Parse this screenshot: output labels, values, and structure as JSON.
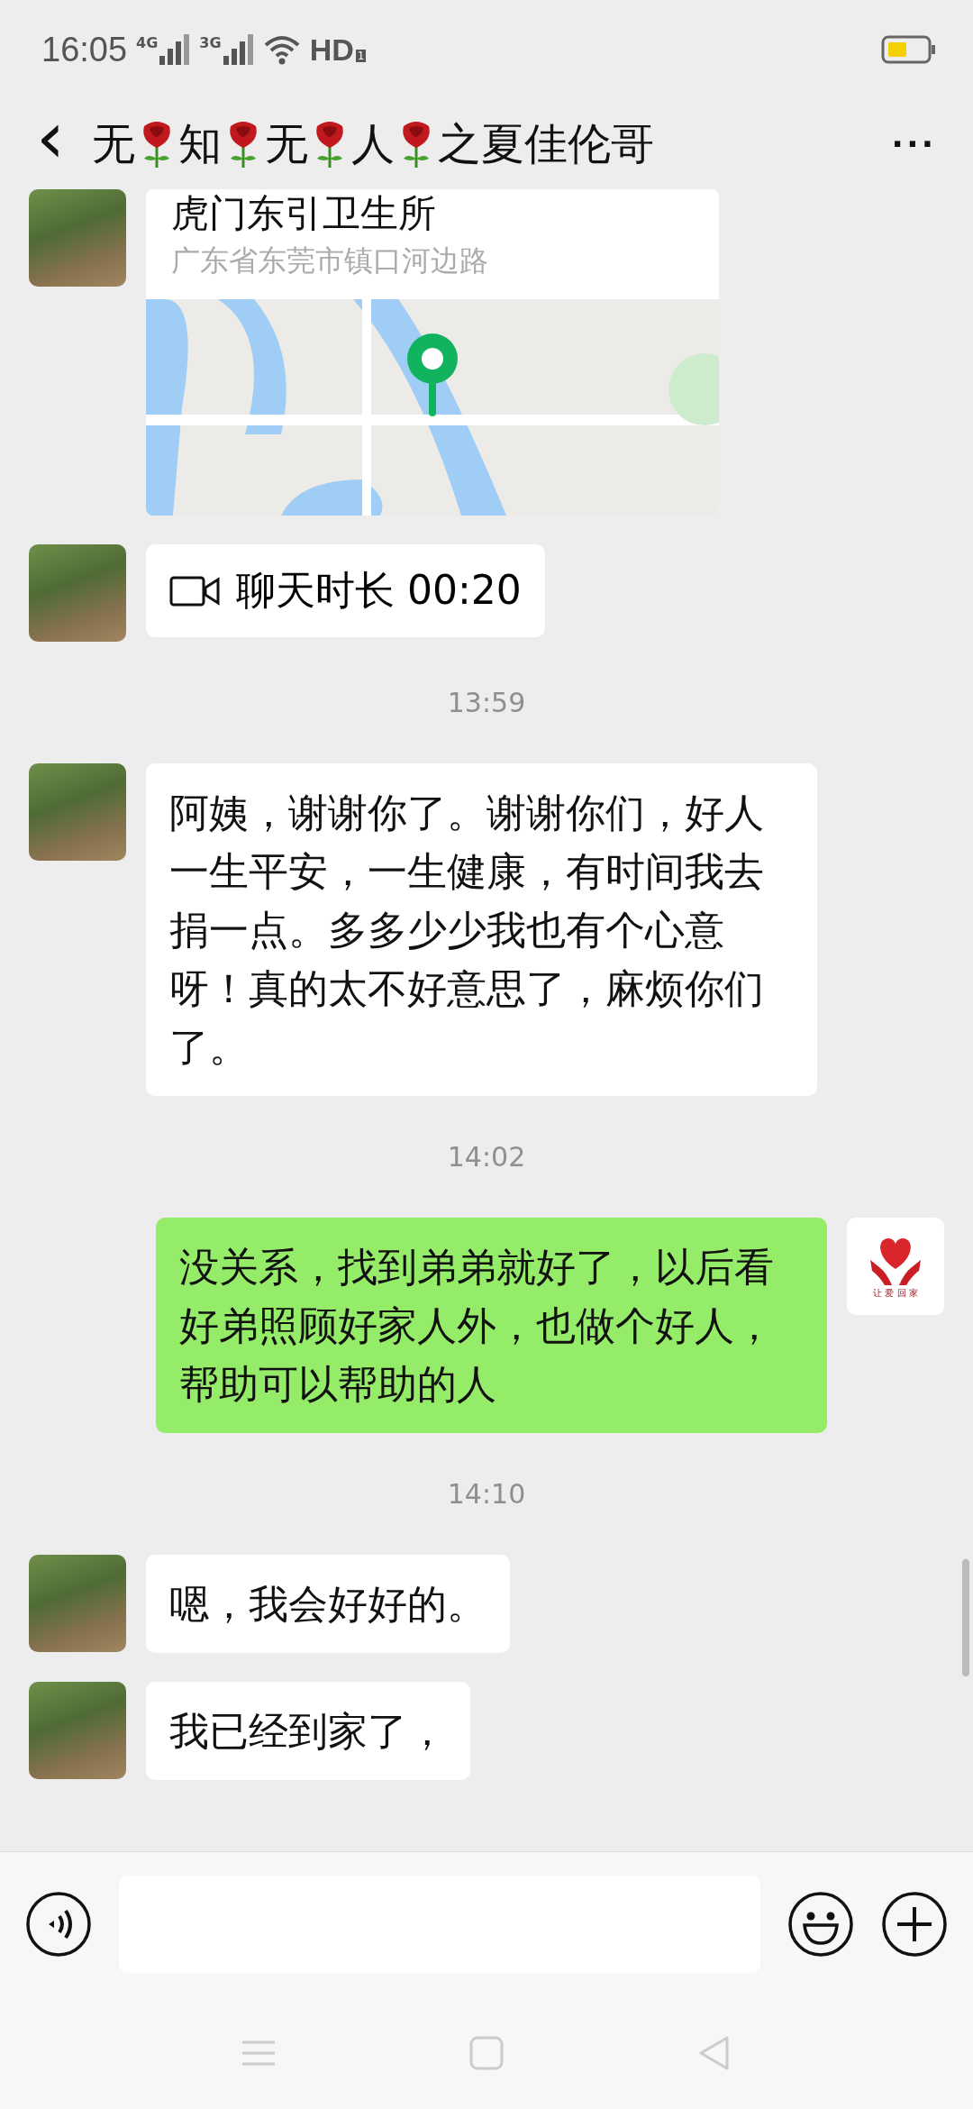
{
  "status_bar": {
    "time": "16:05",
    "network_1": "4G",
    "network_2": "3G",
    "hd": "HD",
    "sim": "1"
  },
  "header": {
    "back": "‹",
    "title": [
      {
        "kind": "text",
        "text": "无"
      },
      {
        "kind": "rose"
      },
      {
        "kind": "text",
        "text": "知"
      },
      {
        "kind": "rose"
      },
      {
        "kind": "text",
        "text": "无"
      },
      {
        "kind": "rose"
      },
      {
        "kind": "text",
        "text": "人"
      },
      {
        "kind": "rose"
      },
      {
        "kind": "text",
        "text": "之夏佳伦哥"
      }
    ],
    "more": "···"
  },
  "messages": [
    {
      "kind": "location",
      "mine": false,
      "title": "虎门东引卫生所",
      "address": "广东省东莞市镇口河边路"
    },
    {
      "kind": "call",
      "mine": false,
      "text": "聊天时长 00:20"
    },
    {
      "kind": "time",
      "text": "13:59"
    },
    {
      "kind": "text",
      "mine": false,
      "text": "阿姨，谢谢你了。谢谢你们，好人一生平安，一生健康，有时间我去捐一点。多多少少我也有个心意呀！真的太不好意思了，麻烦你们了。"
    },
    {
      "kind": "time",
      "text": "14:02"
    },
    {
      "kind": "text",
      "mine": true,
      "text": "没关系，找到弟弟就好了，以后看好弟照顾好家人外，也做个好人，帮助可以帮助的人"
    },
    {
      "kind": "time",
      "text": "14:10"
    },
    {
      "kind": "text",
      "mine": false,
      "text": "嗯，我会好好的。"
    },
    {
      "kind": "text",
      "mine": false,
      "text": "我已经到家了，"
    }
  ],
  "my_avatar": {
    "caption": "让 爱 回 家"
  }
}
